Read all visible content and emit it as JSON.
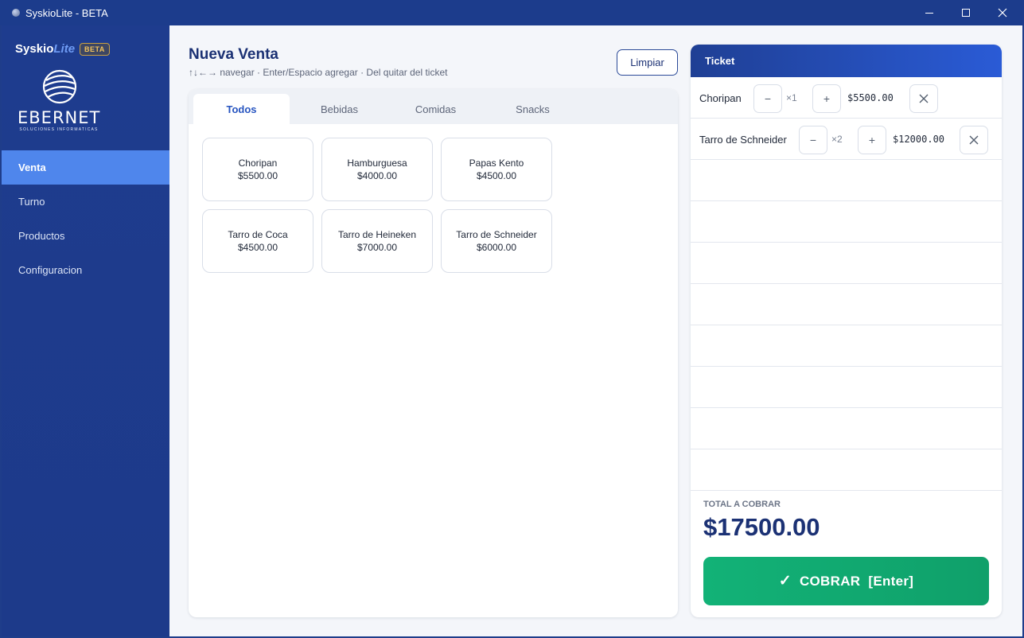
{
  "window": {
    "title": "SyskioLite - BETA",
    "buttons": [
      "minimize",
      "maximize",
      "close"
    ]
  },
  "sidebar": {
    "brand_main": "Syskio",
    "brand_accent": "Lite",
    "brand_badge": "BETA",
    "logo_text": "EBERNET",
    "logo_subtext": "SOLUCIONES INFORMATICAS",
    "items": [
      {
        "label": "Venta",
        "active": true
      },
      {
        "label": "Turno",
        "active": false
      },
      {
        "label": "Productos",
        "active": false
      },
      {
        "label": "Configuracion",
        "active": false
      }
    ]
  },
  "main": {
    "title": "Nueva Venta",
    "hint": "↑↓←→ navegar · Enter/Espacio agregar · Del quitar del ticket",
    "clear_label": "Limpiar",
    "tabs": [
      {
        "label": "Todos",
        "active": true
      },
      {
        "label": "Bebidas",
        "active": false
      },
      {
        "label": "Comidas",
        "active": false
      },
      {
        "label": "Snacks",
        "active": false
      }
    ],
    "products": [
      {
        "name": "Choripan",
        "price": "$5500.00"
      },
      {
        "name": "Hamburguesa",
        "price": "$4000.00"
      },
      {
        "name": "Papas Kento",
        "price": "$4500.00"
      },
      {
        "name": "Tarro de Coca",
        "price": "$4500.00"
      },
      {
        "name": "Tarro de Heineken",
        "price": "$7000.00"
      },
      {
        "name": "Tarro de Schneider",
        "price": "$6000.00"
      }
    ]
  },
  "ticket": {
    "title": "Ticket",
    "items": [
      {
        "name": "Choripan",
        "minus": "−",
        "qty": "×1",
        "plus": "+",
        "price": "$5500.00"
      },
      {
        "name": "Tarro de Schneider",
        "minus": "−",
        "qty": "×2",
        "plus": "+",
        "price": "$12000.00"
      }
    ],
    "total_label": "TOTAL A COBRAR",
    "total_value": "$17500.00",
    "pay_check": "✓",
    "pay_label": "COBRAR  [Enter]"
  },
  "colors": {
    "sidebar": "#1e3c8e",
    "active_nav": "#4f86ec",
    "title": "#1b3174",
    "pay_button": "#12b277"
  }
}
